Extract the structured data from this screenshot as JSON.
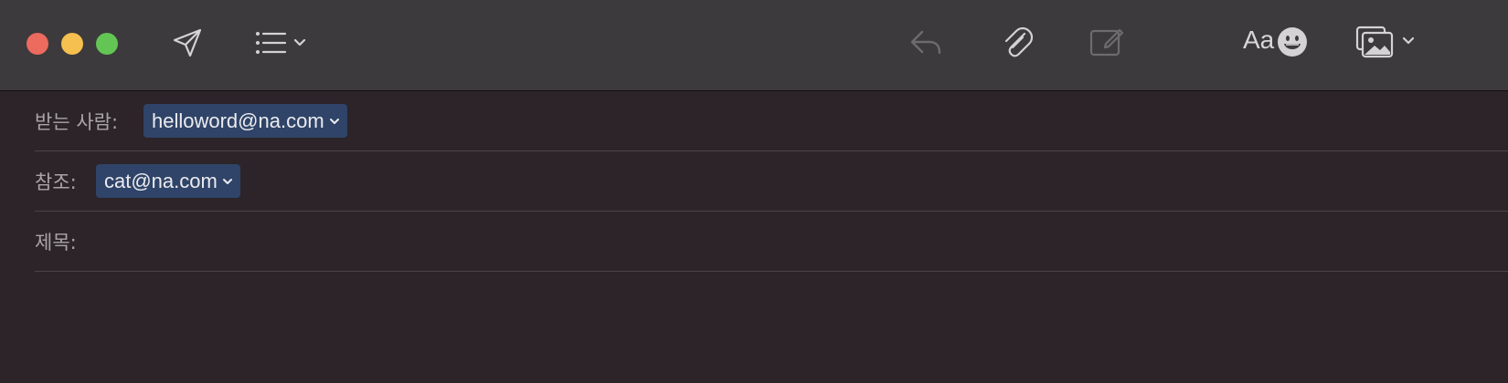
{
  "colors": {
    "close": "#ed6a5e",
    "minimize": "#f5c04f",
    "zoom": "#62c554",
    "recipient_token": "#2f4468",
    "window_bg": "#2c2428",
    "toolbar_bg": "#3c3a3c"
  },
  "toolbar": {
    "send_icon": "paper-plane-icon",
    "header_fields_icon": "list-icon",
    "reply_icon": "reply-arrow-icon",
    "attach_icon": "paperclip-icon",
    "markup_icon": "markup-icon",
    "format_label": "Aa",
    "emoji_icon": "smiley-icon",
    "photo_browser_icon": "photo-icon"
  },
  "fields": {
    "to_label": "받는 사람:",
    "to_recipient": "helloword@na.com",
    "cc_label": "참조:",
    "cc_recipient": "cat@na.com",
    "subject_label": "제목:",
    "subject_value": ""
  }
}
